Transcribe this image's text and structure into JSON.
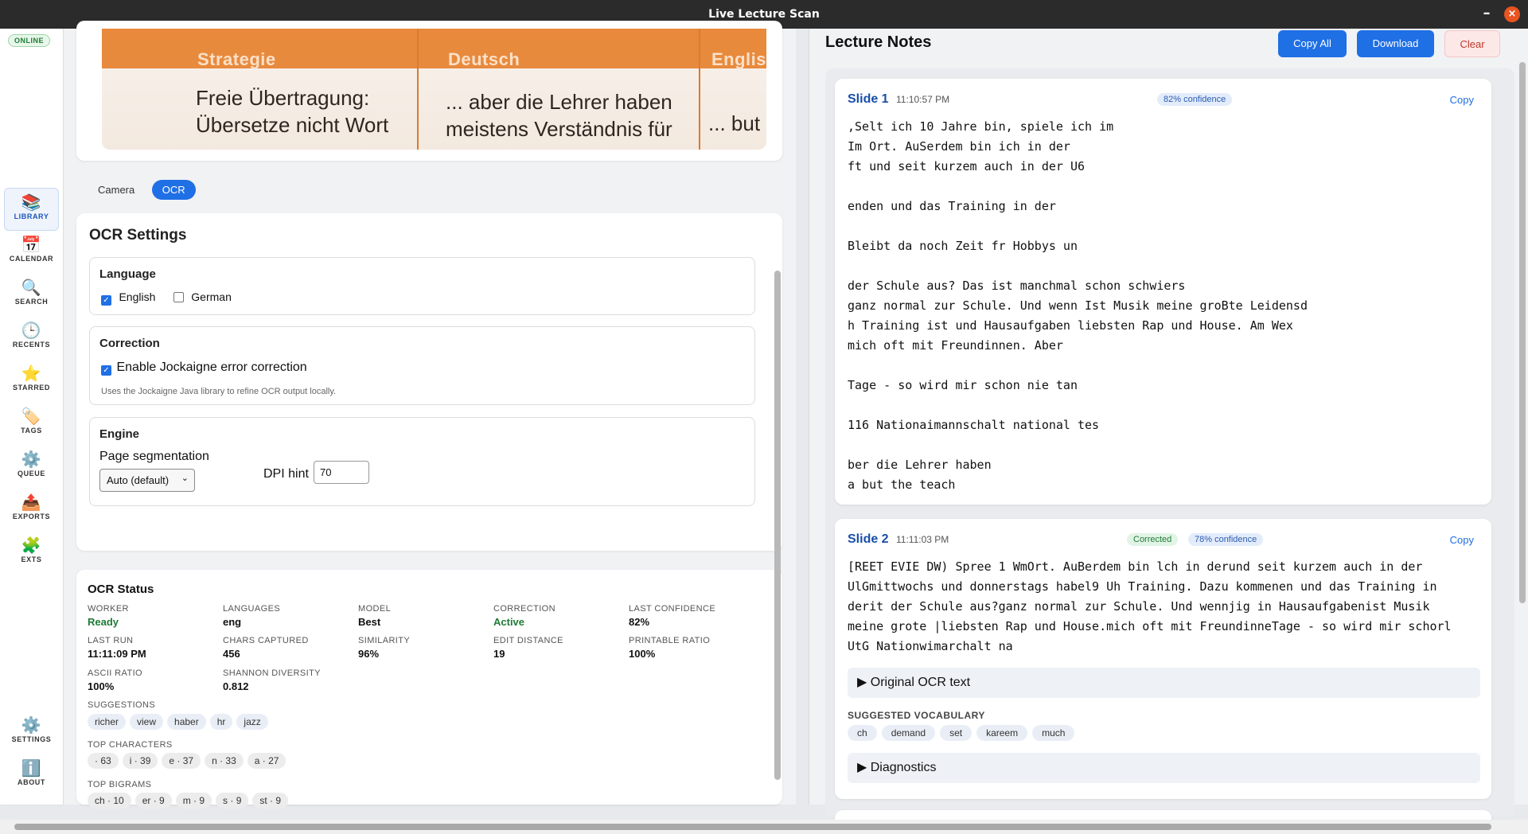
{
  "window": {
    "title": "Live Lecture Scan",
    "minimize": "–",
    "close": "×"
  },
  "status": {
    "online": "ONLINE"
  },
  "nav": {
    "items": [
      {
        "icon": "📚",
        "label": "LIBRARY"
      },
      {
        "icon": "📅",
        "label": "CALENDAR"
      },
      {
        "icon": "🔍",
        "label": "SEARCH"
      },
      {
        "icon": "🕒",
        "label": "RECENTS"
      },
      {
        "icon": "⭐",
        "label": "STARRED"
      },
      {
        "icon": "🏷️",
        "label": "TAGS"
      },
      {
        "icon": "⚙️",
        "label": "QUEUE"
      },
      {
        "icon": "📤",
        "label": "EXPORTS"
      },
      {
        "icon": "🧩",
        "label": "EXTS"
      }
    ],
    "bottom": [
      {
        "icon": "⚙️",
        "label": "SETTINGS"
      },
      {
        "icon": "ℹ️",
        "label": "ABOUT"
      }
    ]
  },
  "camera": {
    "columns": [
      "Strategie",
      "Deutsch",
      "Englis"
    ],
    "lines": {
      "c1a": "Freie Übertragung:",
      "c1b": "Übersetze nicht Wort",
      "c2a": "... aber die Lehrer haben",
      "c2b": "meistens Verständnis für",
      "c3": "... but"
    }
  },
  "tabs": {
    "camera": "Camera",
    "ocr": "OCR"
  },
  "ocr_settings": {
    "title": "OCR Settings",
    "language": {
      "title": "Language",
      "english": "English",
      "german": "German"
    },
    "correction": {
      "title": "Correction",
      "enable": "Enable Jockaigne error correction",
      "hint": "Uses the Jockaigne Java library to refine OCR output locally."
    },
    "engine": {
      "title": "Engine",
      "seg_label": "Page segmentation",
      "seg_value": "Auto (default)",
      "dpi_label": "DPI hint",
      "dpi_value": "70"
    }
  },
  "ocr_status": {
    "title": "OCR Status",
    "worker_l": "WORKER",
    "worker_v": "Ready",
    "languages_l": "LANGUAGES",
    "languages_v": "eng",
    "model_l": "MODEL",
    "model_v": "Best",
    "correction_l": "CORRECTION",
    "correction_v": "Active",
    "lastconf_l": "LAST CONFIDENCE",
    "lastconf_v": "82%",
    "lastrun_l": "LAST RUN",
    "lastrun_v": "11:11:09 PM",
    "chars_l": "CHARS CAPTURED",
    "chars_v": "456",
    "sim_l": "SIMILARITY",
    "sim_v": "96%",
    "edit_l": "EDIT DISTANCE",
    "edit_v": "19",
    "print_l": "PRINTABLE RATIO",
    "print_v": "100%",
    "ascii_l": "ASCII RATIO",
    "ascii_v": "100%",
    "shannon_l": "SHANNON DIVERSITY",
    "shannon_v": "0.812",
    "suggestions_l": "SUGGESTIONS",
    "suggestions": [
      "richer",
      "view",
      "haber",
      "hr",
      "jazz"
    ],
    "topchars_l": "TOP CHARACTERS",
    "topchars": [
      "· 63",
      "i · 39",
      "e · 37",
      "n · 33",
      "a · 27"
    ],
    "bigrams_l": "TOP BIGRAMS",
    "bigrams": [
      "ch · 10",
      "er · 9",
      "m · 9",
      "s · 9",
      "st · 9"
    ]
  },
  "notes": {
    "title": "Lecture Notes",
    "copy_all": "Copy All",
    "download": "Download",
    "clear": "Clear",
    "slide1": {
      "title": "Slide 1",
      "time": "11:10:57 PM",
      "confidence": "82% confidence",
      "copy": "Copy",
      "text": ",Selt ich 10 Jahre bin, spiele ich im\nIm Ort. AuSerdem bin ich in der\nft und seit kurzem auch in der U6\n\nenden und das Training in der\n\nBleibt da noch Zeit fr Hobbys un\n\nder Schule aus? Das ist manchmal schon schwiers\nganz normal zur Schule. Und wenn Ist Musik meine groBte Leidensd\nh Training ist und Hausaufgaben liebsten Rap und House. Am Wex\nmich oft mit Freundinnen. Aber\n\nTage - so wird mir schon nie tan\n\n116 Nationaimannschalt national tes\n\nber die Lehrer haben\na but the teach"
    },
    "slide2": {
      "title": "Slide 2",
      "time": "11:11:03 PM",
      "corrected": "Corrected",
      "confidence": "78% confidence",
      "copy": "Copy",
      "text": "[REET EVIE DW) Spree 1 WmOrt. AuBerdem bin lch in derund seit kurzem auch in der\nUlGmittwochs und donnerstags habel9 Uh Training. Dazu kommenen und das Training in\nderit der Schule aus?ganz normal zur Schule. Und wennjig in Hausaufgabenist Musik\nmeine grote |liebsten Rap und House.mich oft mit FreundinneTage - so wird mir schorl\nUtG Nationwimarchalt na",
      "original": "▶ Original OCR text",
      "vocab_title": "SUGGESTED VOCABULARY",
      "vocab": [
        "ch",
        "demand",
        "set",
        "kareem",
        "much"
      ],
      "diagnostics": "▶ Diagnostics"
    }
  }
}
